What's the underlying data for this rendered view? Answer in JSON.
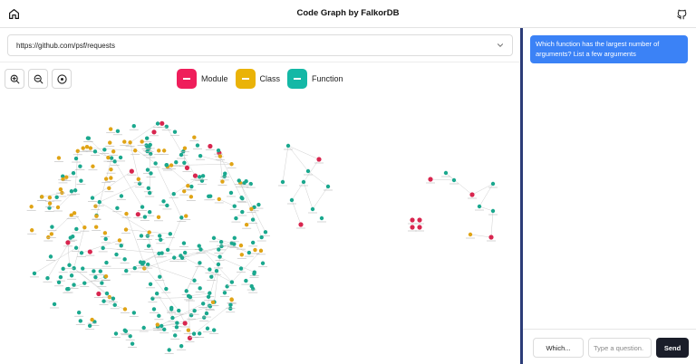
{
  "header": {
    "title": "Code Graph by FalkorDB",
    "home_icon": "home-icon",
    "github_icon": "github-icon"
  },
  "repo": {
    "url": "https://github.com/psf/requests",
    "chevron_icon": "chevron-down-icon"
  },
  "zoom_controls": [
    {
      "name": "zoom-in-button",
      "icon": "zoom-in-icon"
    },
    {
      "name": "zoom-out-button",
      "icon": "zoom-out-icon"
    },
    {
      "name": "center-button",
      "icon": "target-icon"
    }
  ],
  "legend": [
    {
      "label": "Module",
      "color": "#ef1e5b"
    },
    {
      "label": "Class",
      "color": "#eab308"
    },
    {
      "label": "Function",
      "color": "#14b8a6"
    }
  ],
  "colors": {
    "module": "#d8264f",
    "class": "#e0a416",
    "function": "#1aa88e",
    "edge": "#cfcfcf",
    "divider": "#2c3c78",
    "message_bg": "#3b82f6",
    "send_bg": "#1a1d29"
  },
  "chat": {
    "messages": [
      {
        "role": "user",
        "text": "Which function has the largest number of arguments? List a few arguments"
      }
    ],
    "suggestion_label": "Which...",
    "input_placeholder": "Type a question.",
    "send_label": "Send"
  }
}
